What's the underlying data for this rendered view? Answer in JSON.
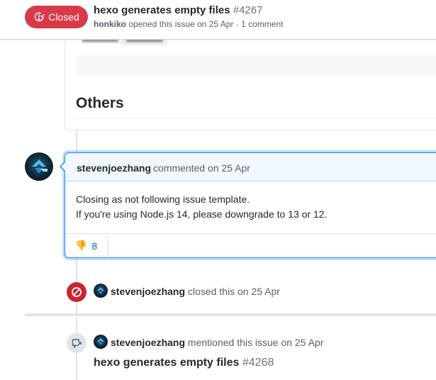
{
  "header": {
    "state": "Closed",
    "title": "hexo generates empty files",
    "number": "#4267",
    "author": "honkiko",
    "meta_text": "opened this issue on 25 Apr · 1 comment"
  },
  "previous_comment": {
    "section_heading": "Others"
  },
  "comment": {
    "author": "stevenjoezhang",
    "when": "commented on 25 Apr",
    "body": [
      "Closing as not following issue template.",
      "If you're using Node.js 14, please downgrade to 13 or 12."
    ],
    "reaction": {
      "emoji": "👎",
      "count": "8"
    }
  },
  "events": {
    "closed": {
      "actor": "stevenjoezhang",
      "text": "closed this on 25 Apr"
    },
    "mentioned": {
      "actor": "stevenjoezhang",
      "text": "mentioned this issue on 25 Apr",
      "ref_title": "hexo generates empty files",
      "ref_number": "#4268"
    }
  },
  "colors": {
    "closed_red": "#d73a49",
    "link_blue": "#0366d6",
    "comment_header_bg": "#f1f8ff"
  },
  "icons": [
    "issue-closed-icon",
    "thumbs-down-icon",
    "circle-slash-icon",
    "cross-reference-icon"
  ]
}
